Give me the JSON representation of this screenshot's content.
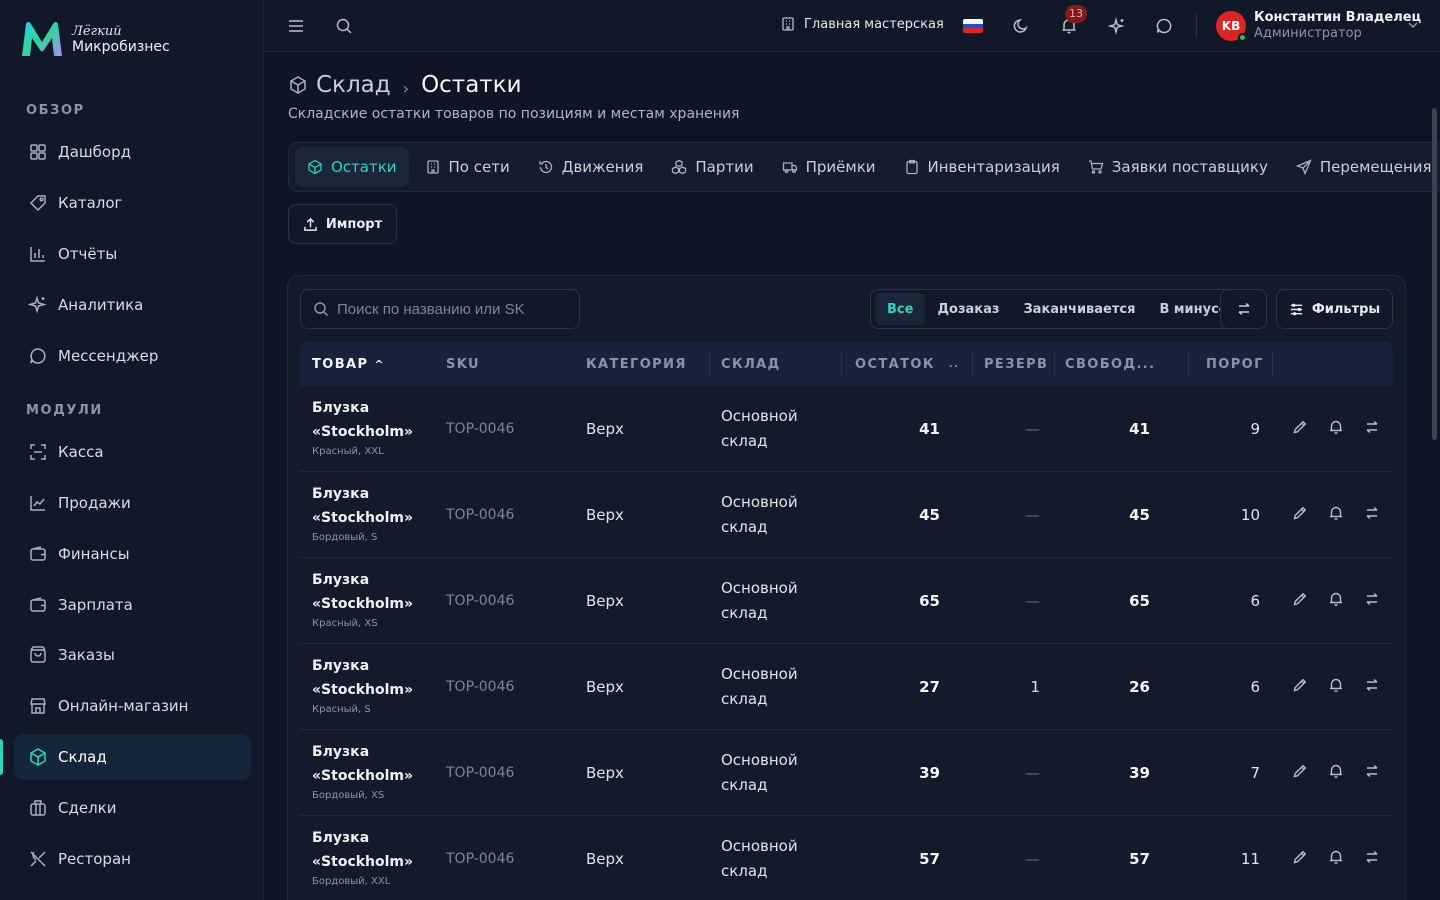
{
  "logo": {
    "sub": "Лёгкий",
    "name": "Микробизнес"
  },
  "sidebar": {
    "sections": [
      {
        "label": "ОБЗОР"
      },
      {
        "label": "МОДУЛИ"
      }
    ],
    "items": [
      {
        "label": "Дашборд",
        "icon": "grid-icon"
      },
      {
        "label": "Каталог",
        "icon": "tag-icon"
      },
      {
        "label": "Отчёты",
        "icon": "bar-chart-icon"
      },
      {
        "label": "Аналитика",
        "icon": "sparkle-icon"
      },
      {
        "label": "Мессенджер",
        "icon": "chat-icon"
      },
      {
        "label": "Касса",
        "icon": "scan-icon"
      },
      {
        "label": "Продажи",
        "icon": "line-chart-icon"
      },
      {
        "label": "Финансы",
        "icon": "wallet-icon"
      },
      {
        "label": "Зарплата",
        "icon": "wallet-icon"
      },
      {
        "label": "Заказы",
        "icon": "bag-icon"
      },
      {
        "label": "Онлайн-магазин",
        "icon": "store-icon"
      },
      {
        "label": "Склад",
        "icon": "box-icon",
        "active": true
      },
      {
        "label": "Сделки",
        "icon": "briefcase-icon"
      },
      {
        "label": "Ресторан",
        "icon": "utensils-icon"
      }
    ]
  },
  "header": {
    "workshop": "Главная мастерская",
    "notifications_count": "13",
    "user": {
      "initials": "KB",
      "name": "Константин Владелец",
      "role": "Администратор"
    }
  },
  "page": {
    "crumb_parent": "Склад",
    "crumb_current": "Остатки",
    "subtitle": "Складские остатки товаров по позициям и местам хранения",
    "import_label": "Импорт"
  },
  "tabs": [
    {
      "label": "Остатки",
      "active": true
    },
    {
      "label": "По сети"
    },
    {
      "label": "Движения"
    },
    {
      "label": "Партии"
    },
    {
      "label": "Приёмки"
    },
    {
      "label": "Инвентаризация"
    },
    {
      "label": "Заявки поставщику"
    },
    {
      "label": "Перемещения"
    }
  ],
  "toolbar": {
    "search_placeholder": "Поиск по названию или SK",
    "segments": [
      {
        "label": "Все",
        "active": true
      },
      {
        "label": "Дозаказ"
      },
      {
        "label": "Заканчивается"
      },
      {
        "label": "В минусе"
      }
    ],
    "filters_label": "Фильтры"
  },
  "table": {
    "columns": [
      "ТОВАР",
      "SKU",
      "КАТЕГОРИЯ",
      "СКЛАД",
      "ОСТАТОК",
      "РЕЗЕРВ",
      "СВОБОД...",
      "ПОРОГ"
    ],
    "sort_indicator": "^",
    "rows": [
      {
        "name": "Блузка «Stockholm»",
        "variant": "Красный, XXL",
        "sku": "TOP-0046",
        "category": "Верх",
        "warehouse": "Основной склад",
        "stock": "41",
        "reserve": "—",
        "free": "41",
        "threshold": "9"
      },
      {
        "name": "Блузка «Stockholm»",
        "variant": "Бордовый, S",
        "sku": "TOP-0046",
        "category": "Верх",
        "warehouse": "Основной склад",
        "stock": "45",
        "reserve": "—",
        "free": "45",
        "threshold": "10"
      },
      {
        "name": "Блузка «Stockholm»",
        "variant": "Красный, XS",
        "sku": "TOP-0046",
        "category": "Верх",
        "warehouse": "Основной склад",
        "stock": "65",
        "reserve": "—",
        "free": "65",
        "threshold": "6"
      },
      {
        "name": "Блузка «Stockholm»",
        "variant": "Красный, S",
        "sku": "TOP-0046",
        "category": "Верх",
        "warehouse": "Основной склад",
        "stock": "27",
        "reserve": "1",
        "free": "26",
        "threshold": "6"
      },
      {
        "name": "Блузка «Stockholm»",
        "variant": "Бордовый, XS",
        "sku": "TOP-0046",
        "category": "Верх",
        "warehouse": "Основной склад",
        "stock": "39",
        "reserve": "—",
        "free": "39",
        "threshold": "7"
      },
      {
        "name": "Блузка «Stockholm»",
        "variant": "Бордовый, XXL",
        "sku": "TOP-0046",
        "category": "Верх",
        "warehouse": "Основной склад",
        "stock": "57",
        "reserve": "—",
        "free": "57",
        "threshold": "11"
      }
    ]
  },
  "colors": {
    "accent": "#2dd4bf",
    "background": "#0f1524",
    "surface": "#131b2b",
    "danger": "#dc2626"
  }
}
